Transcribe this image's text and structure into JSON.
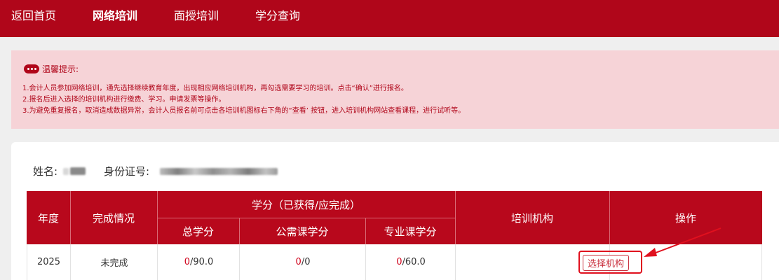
{
  "nav": {
    "items": [
      {
        "label": "返回首页",
        "active": false
      },
      {
        "label": "网络培训",
        "active": true
      },
      {
        "label": "面授培训",
        "active": false
      },
      {
        "label": "学分查询",
        "active": false
      }
    ]
  },
  "notice": {
    "title": "温馨提示:",
    "lines": [
      "1.会计人员参加网络培训，通先选择继续教育年度，出现相应网络培训机构，再勾选需要学习的培训。点击“确认”进行报名。",
      "2.报名后进入选择的培训机构进行缴费、学习。申请发票等操作。",
      "3.为避免重复报名，取消造成数据异常，会计人员报名前可点击各培训机图标右下角的“查看’ 按钮，进入培训机构网站查看课程，进行试听等。"
    ]
  },
  "user": {
    "name_label": "姓名:",
    "id_label": "身份证号:"
  },
  "table": {
    "headers": {
      "year": "年度",
      "status": "完成情况",
      "credits_group": "学分（已获得/应完成）",
      "total": "总学分",
      "public": "公需课学分",
      "professional": "专业课学分",
      "institution": "培训机构",
      "action": "操作"
    },
    "rows": [
      {
        "year": "2025",
        "status": "未完成",
        "total_earned": "0",
        "total_required": "/90.0",
        "public_earned": "0",
        "public_required": "/0",
        "professional_earned": "0",
        "professional_required": "/60.0",
        "institution": "",
        "action_label": "选择机构"
      }
    ]
  },
  "colors": {
    "brand_red": "#b0061a",
    "notice_bg": "#f6d3d7",
    "table_header": "#b8081c",
    "annotation": "#e0101e"
  }
}
